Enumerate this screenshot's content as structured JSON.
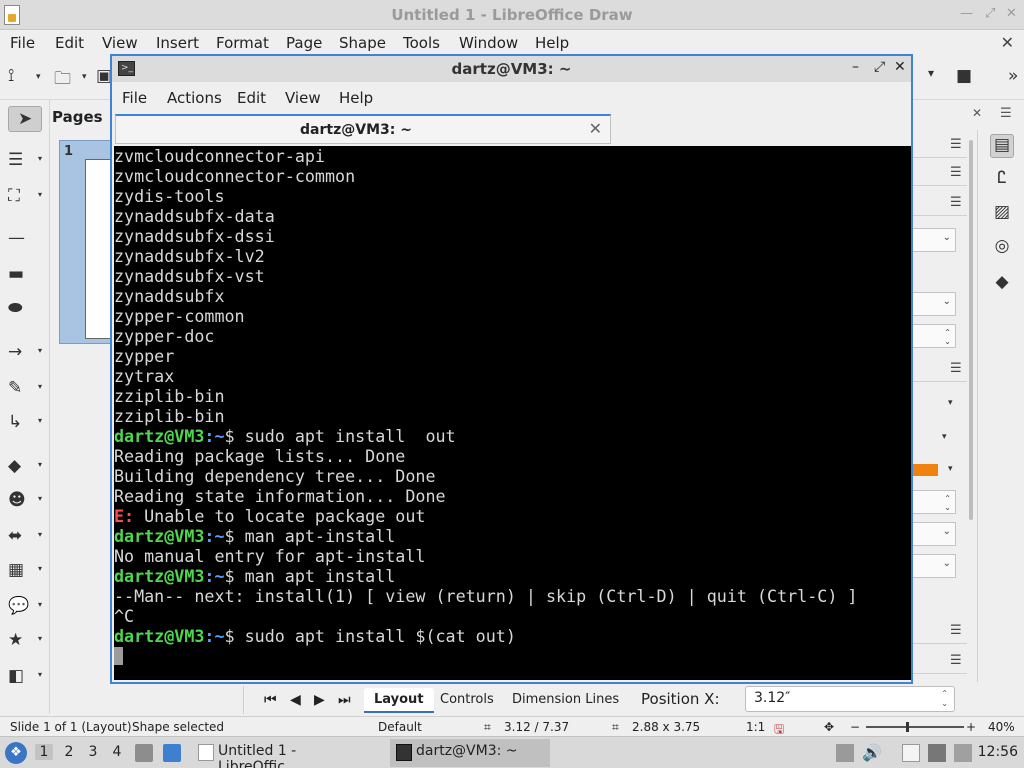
{
  "lo": {
    "title": "Untitled 1 - LibreOffice Draw",
    "menu": [
      "File",
      "Edit",
      "View",
      "Insert",
      "Format",
      "Page",
      "Shape",
      "Tools",
      "Window",
      "Help"
    ],
    "pages_label": "Pages",
    "page_number": "1",
    "bottom_tabs": [
      "Layout",
      "Controls",
      "Dimension Lines"
    ],
    "position_label": "Position X:",
    "position_value": "3.12″",
    "status": {
      "slide": "Slide 1 of 1 (Layout)",
      "selection": "Shape selected",
      "layout": "Default",
      "position": "3.12 / 7.37",
      "size": "2.88 x 3.75",
      "scale": "1:1",
      "zoom": "40%"
    }
  },
  "terminal": {
    "title": "dartz@VM3: ~",
    "menu": [
      "File",
      "Actions",
      "Edit",
      "View",
      "Help"
    ],
    "tab_title": "dartz@VM3: ~",
    "prompt_user": "dartz@VM3",
    "prompt_path": ":~",
    "lines": [
      {
        "type": "text",
        "text": "zvmcloudconnector-api"
      },
      {
        "type": "text",
        "text": "zvmcloudconnector-common"
      },
      {
        "type": "text",
        "text": "zydis-tools"
      },
      {
        "type": "text",
        "text": "zynaddsubfx-data"
      },
      {
        "type": "text",
        "text": "zynaddsubfx-dssi"
      },
      {
        "type": "text",
        "text": "zynaddsubfx-lv2"
      },
      {
        "type": "text",
        "text": "zynaddsubfx-vst"
      },
      {
        "type": "text",
        "text": "zynaddsubfx"
      },
      {
        "type": "text",
        "text": "zypper-common"
      },
      {
        "type": "text",
        "text": "zypper-doc"
      },
      {
        "type": "text",
        "text": "zypper"
      },
      {
        "type": "text",
        "text": "zytrax"
      },
      {
        "type": "text",
        "text": "zziplib-bin"
      },
      {
        "type": "text",
        "text": "zziplib-bin"
      },
      {
        "type": "prompt",
        "text": "$ sudo apt install  out"
      },
      {
        "type": "text",
        "text": "Reading package lists... Done"
      },
      {
        "type": "text",
        "text": "Building dependency tree... Done"
      },
      {
        "type": "text",
        "text": "Reading state information... Done"
      },
      {
        "type": "error",
        "tag": "E:",
        "text": " Unable to locate package out"
      },
      {
        "type": "prompt",
        "text": "$ man apt-install"
      },
      {
        "type": "text",
        "text": "No manual entry for apt-install"
      },
      {
        "type": "prompt",
        "text": "$ man apt install"
      },
      {
        "type": "text",
        "text": "--Man-- next: install(1) [ view (return) | skip (Ctrl-D) | quit (Ctrl-C) ]"
      },
      {
        "type": "text",
        "text": "^C"
      },
      {
        "type": "prompt",
        "text": "$ sudo apt install $(cat out)"
      },
      {
        "type": "cursor",
        "text": ""
      }
    ]
  },
  "taskbar": {
    "workspaces": [
      "1",
      "2",
      "3",
      "4"
    ],
    "tasks": [
      "Untitled 1 - LibreOffic...",
      "dartz@VM3: ~"
    ],
    "clock": "12:56"
  },
  "colors": {
    "terminal_bg": "#000000",
    "prompt_user": "#4fd64f",
    "prompt_path": "#5a9bff",
    "error": "#ff4b4b",
    "window_accent": "#3c84d6"
  }
}
